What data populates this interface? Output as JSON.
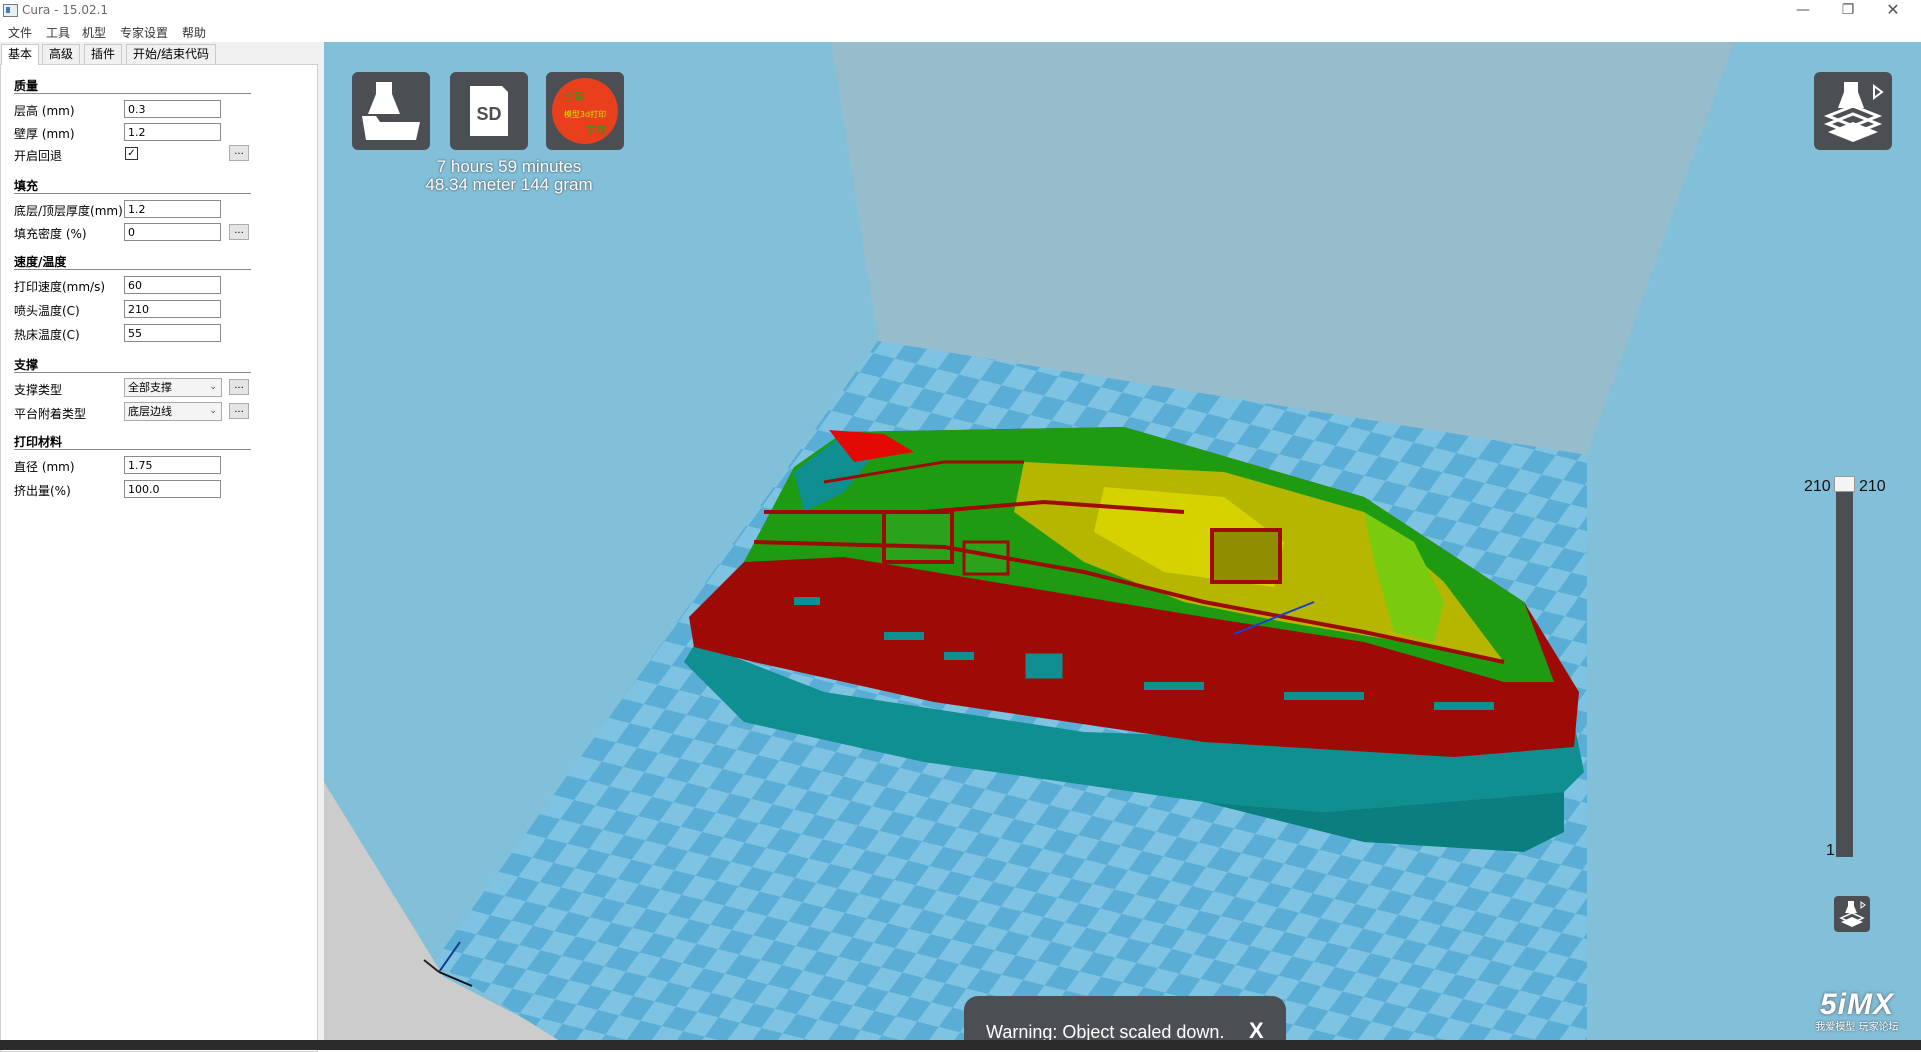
{
  "window": {
    "title": "Cura - 15.02.1",
    "minimize_icon": "—",
    "restore_icon": "❐",
    "close_icon": "✕"
  },
  "menu": {
    "items": [
      "文件",
      "工具",
      "机型",
      "专家设置",
      "帮助"
    ]
  },
  "tabs": [
    "基本",
    "高级",
    "插件",
    "开始/结束代码"
  ],
  "settings": {
    "quality": {
      "title": "质量",
      "layer_height_label": "层高 (mm)",
      "layer_height_value": "0.3",
      "shell_thickness_label": "壁厚 (mm)",
      "shell_thickness_value": "1.2",
      "retraction_label": "开启回退",
      "retraction_checked": "✓"
    },
    "fill": {
      "title": "填充",
      "bottom_top_label": "底层/顶层厚度(mm)",
      "bottom_top_value": "1.2",
      "density_label": "填充密度 (%)",
      "density_value": "0"
    },
    "speed": {
      "title": "速度/温度",
      "print_speed_label": "打印速度(mm/s)",
      "print_speed_value": "60",
      "nozzle_temp_label": "喷头温度(C)",
      "nozzle_temp_value": "210",
      "bed_temp_label": "热床温度(C)",
      "bed_temp_value": "55"
    },
    "support": {
      "title": "支撑",
      "support_type_label": "支撑类型",
      "support_type_value": "全部支撑",
      "adhesion_label": "平台附着类型",
      "adhesion_value": "底层边线"
    },
    "filament": {
      "title": "打印材料",
      "diameter_label": "直径 (mm)",
      "diameter_value": "1.75",
      "flow_label": "挤出量(%)",
      "flow_value": "100.0"
    },
    "more_label": "...",
    "chevron": "⌄"
  },
  "viewport": {
    "print_time": "7 hours 59 minutes",
    "print_material": "48.34 meter 144 gram",
    "sd_label": "SD",
    "share_label": "分享",
    "share_sub": "模型3d打印",
    "share_download": "下载",
    "layer_top_left": "210",
    "layer_top_right": "210",
    "layer_bottom": "1",
    "warning_text": "Warning: Object scaled down.",
    "warning_close": "X",
    "watermark_logo": "5iMX",
    "watermark_sub": "我爱模型 玩家论坛"
  },
  "colors": {
    "viewport_bg": "#82bfd9",
    "button_bg": "#4b4f54",
    "model_red": "#9e0a06",
    "model_green": "#1f9b12",
    "model_yellow": "#c8c400",
    "support_teal": "#0f8f8f"
  }
}
